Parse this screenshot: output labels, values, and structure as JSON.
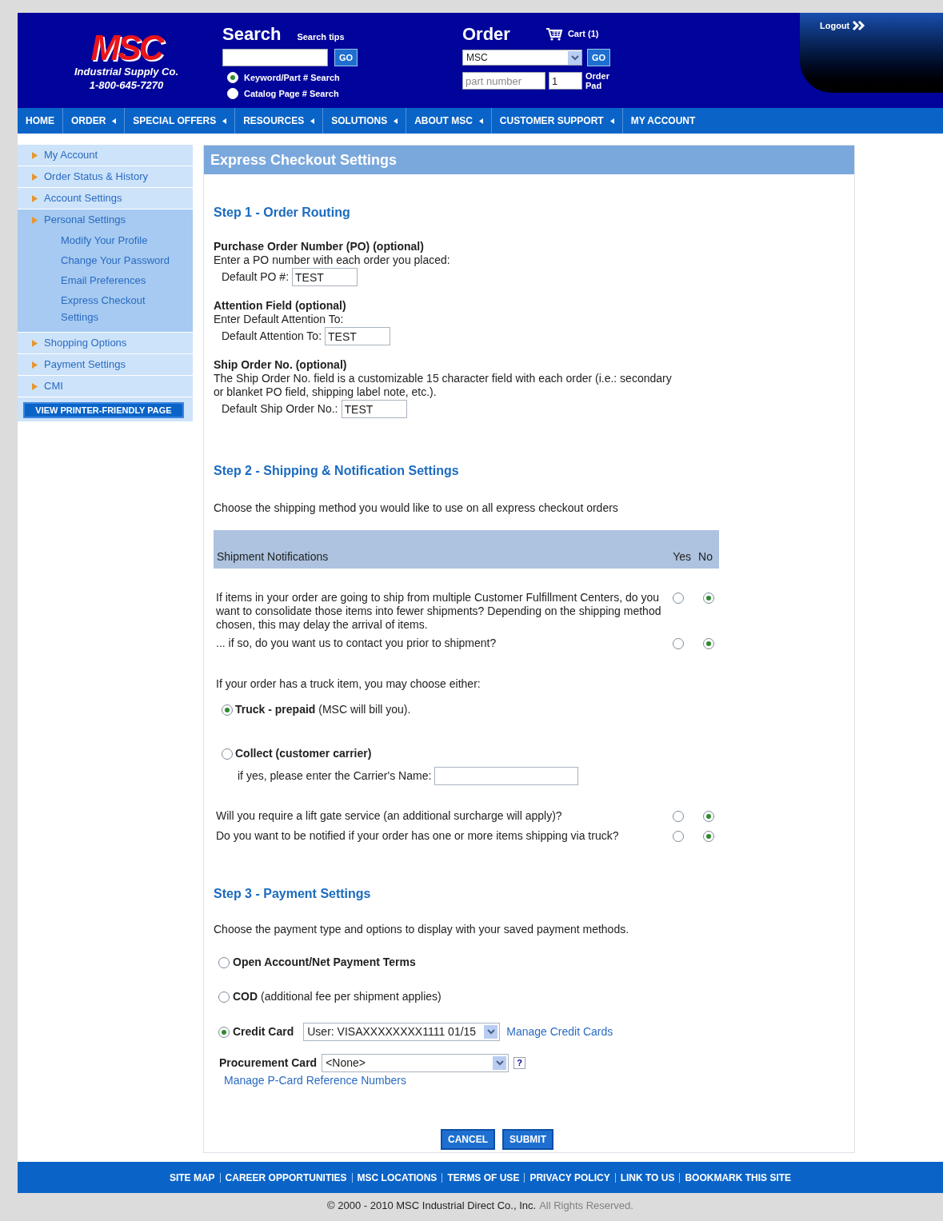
{
  "header": {
    "logo": "MSC",
    "company": "Industrial Supply Co.",
    "phone": "1-800-645-7270",
    "search": {
      "title": "Search",
      "tips": "Search tips",
      "go": "GO",
      "options": [
        {
          "label": "Keyword/Part # Search",
          "selected": true
        },
        {
          "label": "Catalog Page # Search",
          "selected": false
        }
      ]
    },
    "order": {
      "title": "Order",
      "cart": "Cart (1)",
      "catalog": "MSC",
      "go": "GO",
      "part_placeholder": "part number",
      "quantity": "1",
      "order_pad": "Order Pad"
    },
    "logout": "Logout"
  },
  "nav": [
    {
      "label": "HOME",
      "menu": false
    },
    {
      "label": "ORDER",
      "menu": true
    },
    {
      "label": "SPECIAL OFFERS",
      "menu": true
    },
    {
      "label": "RESOURCES",
      "menu": true
    },
    {
      "label": "SOLUTIONS",
      "menu": true
    },
    {
      "label": "ABOUT MSC",
      "menu": true
    },
    {
      "label": "CUSTOMER SUPPORT",
      "menu": true
    },
    {
      "label": "MY ACCOUNT",
      "menu": false
    }
  ],
  "sidebar": {
    "items": [
      {
        "label": "My Account",
        "expanded": false
      },
      {
        "label": "Order Status & History",
        "expanded": false
      },
      {
        "label": "Account Settings",
        "expanded": false
      },
      {
        "label": "Personal Settings",
        "expanded": true,
        "children": [
          {
            "label": "Modify Your Profile"
          },
          {
            "label": "Change Your Password"
          },
          {
            "label": "Email Preferences"
          },
          {
            "label": "Express Checkout Settings"
          }
        ]
      },
      {
        "label": "Shopping Options",
        "expanded": false
      },
      {
        "label": "Payment Settings",
        "expanded": false
      },
      {
        "label": "CMI",
        "expanded": false
      }
    ],
    "printer_button": "VIEW PRINTER-FRIENDLY PAGE"
  },
  "page_title": "Express Checkout Settings",
  "step1": {
    "heading": "Step 1 - Order Routing",
    "fields": [
      {
        "title": "Purchase Order Number (PO) (optional)",
        "description": "Enter a PO number with each order you placed:",
        "label": "Default PO #:",
        "value": "TEST"
      },
      {
        "title": "Attention Field (optional)",
        "description": "Enter Default Attention To:",
        "label": "Default Attention To:",
        "value": "TEST"
      },
      {
        "title": "Ship Order No. (optional)",
        "description": "The Ship Order No. field is a customizable 15 character field with each order (i.e.: secondary or blanket PO field, shipping label note, etc.).",
        "label": "Default Ship Order No.:",
        "value": "TEST"
      }
    ]
  },
  "step2": {
    "heading": "Step 2 - Shipping & Notification Settings",
    "intro": "Choose the shipping method you would like to use on all express checkout orders",
    "table_header": {
      "title": "Shipment Notifications",
      "yes": "Yes",
      "no": "No"
    },
    "questions": [
      {
        "text": "If items in your order are going to ship from multiple Customer Fulfillment Centers, do you want to consolidate those items into fewer shipments? Depending on the shipping method chosen, this may delay the arrival of items.",
        "yes": {
          "selected": false
        },
        "no": {
          "selected": true
        }
      },
      {
        "text": "... if so, do you want us to contact you prior to shipment?",
        "yes": {
          "selected": false
        },
        "no": {
          "selected": true
        }
      }
    ],
    "truck_intro": "If your order has a truck item, you may choose either:",
    "truck_options": [
      {
        "label": "**Truck - prepaid** (MSC will bill you).",
        "selected": true
      },
      {
        "label": "**Collect (customer carrier)**",
        "selected": false
      }
    ],
    "carrier_label": "if yes, please enter the Carrier's Name:",
    "more_questions": [
      {
        "text": "Will you require a lift gate service (an additional surcharge will apply)?",
        "yes": {
          "selected": false
        },
        "no": {
          "selected": true
        }
      },
      {
        "text": "Do you want to be notified if your order has one or more items shipping via truck?",
        "yes": {
          "selected": false
        },
        "no": {
          "selected": true
        }
      }
    ]
  },
  "step3": {
    "heading": "Step 3 - Payment Settings",
    "intro": "Choose the payment type and options to display with your saved payment methods.",
    "options": [
      {
        "label": "**Open Account/Net Payment Terms**",
        "selected": false
      },
      {
        "label": "**COD** (additional fee per shipment applies)",
        "selected": false
      },
      {
        "label": "**Credit Card**",
        "selected": true
      }
    ],
    "card_select": "User: VISAXXXXXXXX1111 01/15",
    "manage_cards": "Manage Credit Cards",
    "procurement_label": "Procurement Card",
    "procurement_select": "<None>",
    "help": "?",
    "manage_pcard": "Manage P-Card Reference Numbers"
  },
  "buttons": [
    "CANCEL",
    "SUBMIT"
  ],
  "footer_links": [
    "SITE MAP",
    "CAREER OPPORTUNITIES",
    "MSC LOCATIONS",
    "TERMS OF USE",
    "PRIVACY POLICY",
    "LINK TO US",
    "BOOKMARK THIS SITE"
  ],
  "copyright": "© 2000 - 2010 MSC Industrial Direct Co., Inc.",
  "rights": "All Rights Reserved."
}
